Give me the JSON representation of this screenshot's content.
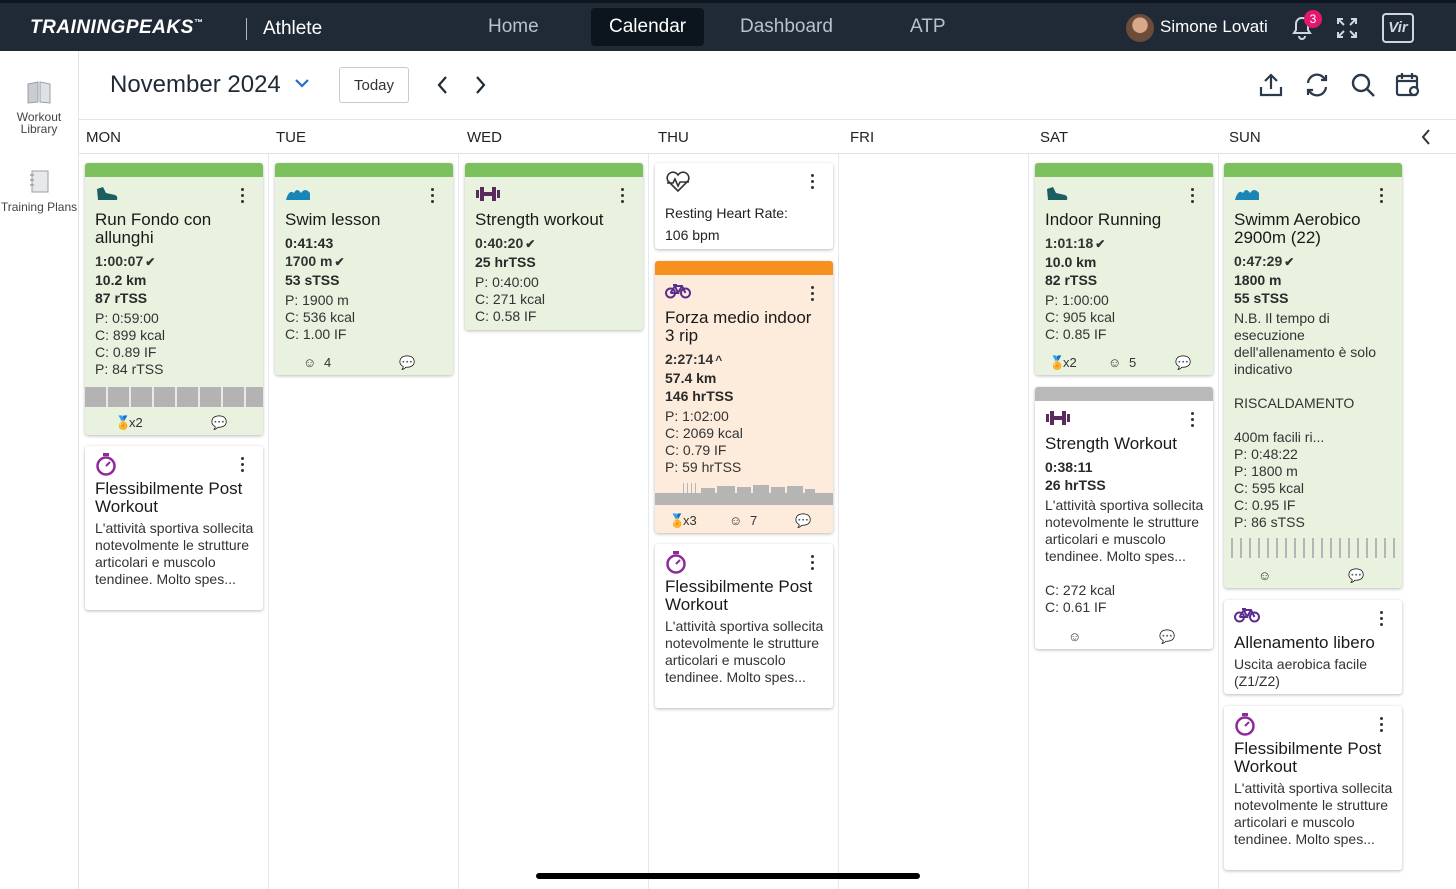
{
  "app": {
    "logo": "TRAININGPEAKS",
    "logo_tm": "™",
    "product": "Athlete",
    "nav": [
      "Home",
      "Calendar",
      "Dashboard",
      "ATP"
    ],
    "active_nav": "Calendar",
    "user": "Simone Lovati",
    "notifications": "3",
    "vir": "Vir"
  },
  "sidebar": {
    "library": "Workout Library",
    "plans": "Training Plans"
  },
  "header": {
    "month": "November 2024",
    "today": "Today"
  },
  "days": [
    "MON",
    "TUE",
    "WED",
    "THU",
    "FRI",
    "SAT",
    "SUN"
  ],
  "colors": {
    "completed": "#7cc15e",
    "over": "#f7901e",
    "unplanned": "#b9b9b9",
    "run": "#1d5e63",
    "swim": "#1a86b5",
    "strength": "#5a2a5e",
    "bike": "#5b2d8e",
    "flex": "#8e2a9a"
  },
  "cards": {
    "mon1": {
      "icon": "running-shoe-icon",
      "title": "Run Fondo con allunghi",
      "duration": "1:00:07",
      "distance": "10.2 km",
      "load": "87 rTSS",
      "p": "P: 0:59:00",
      "c1": "C: 899 kcal",
      "c2": "C: 0.89 IF",
      "p2": "P: 84 rTSS",
      "medal": "x2"
    },
    "mon2": {
      "icon": "stopwatch-icon",
      "title": "Flessibilmente Post Workout",
      "desc": "L'attività sportiva sollecita notevolmente le strutture articolari e muscolo tendinee. Molto spes..."
    },
    "tue1": {
      "icon": "swim-wave-icon",
      "title": "Swim lesson",
      "duration": "0:41:43",
      "distance": "1700 m",
      "load": "53 sTSS",
      "p": "P: 1900 m",
      "c1": "C: 536 kcal",
      "c2": "C: 1.00 IF",
      "smile": "4"
    },
    "wed1": {
      "icon": "dumbbell-icon",
      "title": "Strength workout",
      "duration": "0:40:20",
      "load": "25 hrTSS",
      "p": "P: 0:40:00",
      "c1": "C: 271 kcal",
      "c2": "C: 0.58 IF"
    },
    "thu1": {
      "icon": "heart-rate-icon",
      "label": "Resting Heart Rate:",
      "value": "106 bpm"
    },
    "thu2": {
      "icon": "bike-icon",
      "title": "Forza medio indoor 3 rip",
      "duration": "2:27:14",
      "distance": "57.4 km",
      "load": "146 hrTSS",
      "p": "P: 1:02:00",
      "c1": "C: 2069 kcal",
      "c2": "C: 0.79 IF",
      "p2": "P: 59 hrTSS",
      "medal": "x3",
      "smile": "7"
    },
    "thu3": {
      "icon": "stopwatch-icon",
      "title": "Flessibilmente Post Workout",
      "desc": "L'attività sportiva sollecita notevolmente le strutture articolari e muscolo tendinee. Molto spes..."
    },
    "sat1": {
      "icon": "running-shoe-icon",
      "title": "Indoor Running",
      "duration": "1:01:18",
      "distance": "10.0 km",
      "load": "82 rTSS",
      "p": "P: 1:00:00",
      "c1": "C: 905 kcal",
      "c2": "C: 0.85 IF",
      "medal": "x2",
      "smile": "5"
    },
    "sat2": {
      "icon": "dumbbell-icon",
      "title": "Strength Workout",
      "duration": "0:38:11",
      "load": "26 hrTSS",
      "desc": "L'attività sportiva sollecita notevolmente le strutture articolari e muscolo tendinee. Molto spes...",
      "c1": "C: 272 kcal",
      "c2": "C: 0.61 IF"
    },
    "sun1": {
      "icon": "swim-wave-icon",
      "title": "Swimm Aerobico 2900m (22)",
      "duration": "0:47:29",
      "distance": "1800 m",
      "load": "55 sTSS",
      "desc1": "N.B. Il tempo di esecuzione dell'allenamento è solo indicativo",
      "desc2": "RISCALDAMENTO",
      "desc3": "400m facili ri...",
      "p": "P: 0:48:22",
      "p2": "P: 1800 m",
      "c1": "C: 595 kcal",
      "c2": "C: 0.95 IF",
      "p3": "P: 86 sTSS"
    },
    "sun2": {
      "icon": "bike-icon",
      "title": "Allenamento libero",
      "desc": "Uscita aerobica facile (Z1/Z2)"
    },
    "sun3": {
      "icon": "stopwatch-icon",
      "title": "Flessibilmente Post Workout",
      "desc": "L'attività sportiva sollecita notevolmente le strutture articolari e muscolo tendinee. Molto spes..."
    }
  }
}
